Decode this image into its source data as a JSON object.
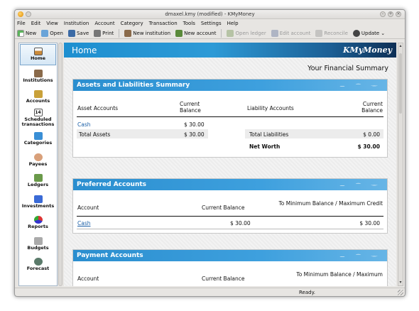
{
  "window": {
    "title": "dmaxel.kmy (modified) - KMyMoney"
  },
  "menu": [
    "File",
    "Edit",
    "View",
    "Institution",
    "Account",
    "Category",
    "Transaction",
    "Tools",
    "Settings",
    "Help"
  ],
  "toolbar": [
    {
      "label": "New",
      "icon": "new-file-icon",
      "enabled": true
    },
    {
      "label": "Open",
      "icon": "open-folder-icon",
      "enabled": true
    },
    {
      "label": "Save",
      "icon": "save-disk-icon",
      "enabled": true
    },
    {
      "label": "Print",
      "icon": "printer-icon",
      "enabled": true
    },
    {
      "label": "New institution",
      "icon": "new-institution-icon",
      "enabled": true
    },
    {
      "label": "New account",
      "icon": "new-account-icon",
      "enabled": true
    },
    {
      "label": "Open ledger",
      "icon": "ledger-icon",
      "enabled": false
    },
    {
      "label": "Edit account",
      "icon": "edit-account-icon",
      "enabled": false
    },
    {
      "label": "Reconcile",
      "icon": "reconcile-icon",
      "enabled": false
    },
    {
      "label": "Update",
      "icon": "update-icon",
      "enabled": true
    }
  ],
  "sidebar": [
    {
      "label": "Home",
      "icon": "home-icon",
      "active": true
    },
    {
      "label": "Institutions",
      "icon": "institutions-icon"
    },
    {
      "label": "Accounts",
      "icon": "accounts-icon"
    },
    {
      "label": "Scheduled transactions",
      "icon": "calendar-icon",
      "badge": "14"
    },
    {
      "label": "Categories",
      "icon": "categories-icon"
    },
    {
      "label": "Payees",
      "icon": "payees-icon"
    },
    {
      "label": "Ledgers",
      "icon": "ledgers-icon"
    },
    {
      "label": "Investments",
      "icon": "investments-icon"
    },
    {
      "label": "Reports",
      "icon": "reports-icon"
    },
    {
      "label": "Budgets",
      "icon": "budgets-icon"
    },
    {
      "label": "Forecast",
      "icon": "forecast-icon"
    }
  ],
  "header": {
    "title": "Home",
    "logo": "KMyMoney"
  },
  "summary_title": "Your Financial Summary",
  "assets": {
    "title": "Assets and Liabilities Summary",
    "col_asset": "Asset Accounts",
    "col_current": "Current Balance",
    "col_liab": "Liability Accounts",
    "col_current2": "Current Balance",
    "asset_name": "Cash",
    "asset_value": "$ 30.00",
    "total_assets_label": "Total Assets",
    "total_assets": "$ 30.00",
    "total_liab_label": "Total Liabilities",
    "total_liab": "$ 0.00",
    "net_worth_label": "Net Worth",
    "net_worth": "$ 30.00"
  },
  "preferred": {
    "title": "Preferred Accounts",
    "col_account": "Account",
    "col_balance": "Current Balance",
    "col_min": "To Minimum Balance / Maximum Credit",
    "row_name": "Cash",
    "row_balance": "$ 30.00",
    "row_min": "$ 30.00"
  },
  "payment": {
    "title": "Payment Accounts",
    "col_account": "Account",
    "col_balance": "Current Balance",
    "col_min": "To Minimum Balance / Maximum"
  },
  "status": "Ready."
}
